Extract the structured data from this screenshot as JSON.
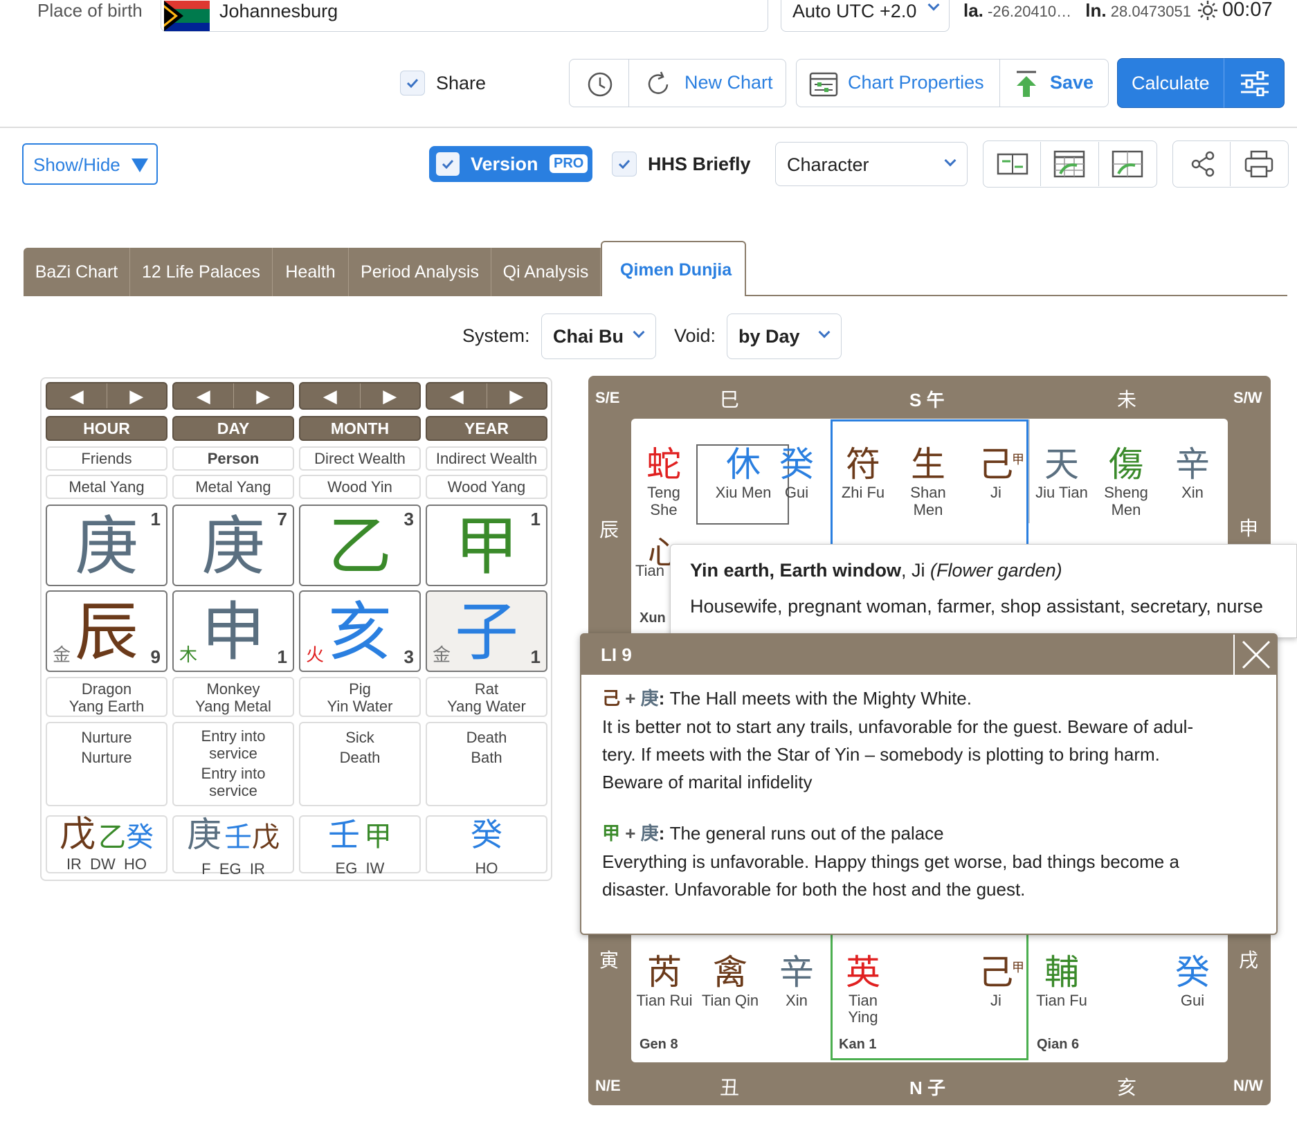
{
  "top": {
    "place_label": "Place of birth",
    "city": "Johannesburg",
    "tz": "Auto UTC +2.0",
    "lat_label": "la.",
    "lat": "-26.20410…",
    "lon_label": "ln.",
    "lon": "28.0473051",
    "time": "00:07"
  },
  "toolbar": {
    "share": "Share",
    "new_chart": "New Chart",
    "chart_props": "Chart Properties",
    "save": "Save",
    "calculate": "Calculate"
  },
  "toolbar2": {
    "show_hide": "Show/Hide",
    "version": "Version",
    "pro": "PRO",
    "hhs": "HHS Briefly",
    "character": "Character"
  },
  "tabs": [
    "BaZi Chart",
    "12 Life Palaces",
    "Health",
    "Period Analysis",
    "Qi Analysis",
    "Qimen Dunjia"
  ],
  "system": {
    "label": "System:",
    "value": "Chai Bu",
    "void_label": "Void:",
    "void_value": "by Day"
  },
  "pillars": [
    {
      "head": "HOUR",
      "rel": "Friends",
      "elem": "Metal Yang",
      "stem": "庚",
      "stem_n": "1",
      "stem_c": "#5a6f80",
      "branch": "辰",
      "branch_c": "#6b3a1a",
      "bel": "金",
      "bel_c": "#777",
      "bn": "9",
      "animal": "Dragon",
      "animal2": "Yang Earth",
      "st1": "Nurture",
      "st2": "Nurture",
      "st3": "",
      "st4": "",
      "h1": "戊",
      "h1c": "#6b3a1a",
      "h2": "乙",
      "h2c": "#3a8a2a",
      "h3": "癸",
      "h3c": "#2a7fe0",
      "hl": "IR  DW  HO"
    },
    {
      "head": "DAY",
      "rel": "Person",
      "elem": "Metal Yang",
      "stem": "庚",
      "stem_n": "7",
      "stem_c": "#5a6f80",
      "branch": "申",
      "branch_c": "#5a6f80",
      "bel": "木",
      "bel_c": "#3a8a2a",
      "bn": "1",
      "animal": "Monkey",
      "animal2": "Yang Metal",
      "st1": "Entry into",
      "st2": "service",
      "st3": "Entry into",
      "st4": "service",
      "h1": "庚",
      "h1c": "#5a6f80",
      "h2": "壬",
      "h2c": "#2a7fe0",
      "h3": "戊",
      "h3c": "#6b3a1a",
      "hl": "F  EG  IR"
    },
    {
      "head": "MONTH",
      "rel": "Direct Wealth",
      "elem": "Wood Yin",
      "stem": "乙",
      "stem_n": "3",
      "stem_c": "#3a8a2a",
      "branch": "亥",
      "branch_c": "#2a7fe0",
      "bel": "火",
      "bel_c": "#e02020",
      "bn": "3",
      "animal": "Pig",
      "animal2": "Yin Water",
      "st1": "Sick",
      "st2": "Death",
      "st3": "",
      "st4": "",
      "h1": "壬",
      "h1c": "#2a7fe0",
      "h2": "甲",
      "h2c": "#3a8a2a",
      "h3": "",
      "h3c": "#fff",
      "hl": "EG  IW"
    },
    {
      "head": "YEAR",
      "rel": "Indirect Wealth",
      "elem": "Wood Yang",
      "stem": "甲",
      "stem_n": "1",
      "stem_c": "#3a8a2a",
      "branch": "子",
      "branch_c": "#2a7fe0",
      "bel": "金",
      "bel_c": "#777",
      "bn": "1",
      "animal": "Rat",
      "animal2": "Yang Water",
      "st1": "Death",
      "st2": "Bath",
      "st3": "",
      "st4": "",
      "h1": "癸",
      "h1c": "#2a7fe0",
      "h2": "",
      "h2c": "#fff",
      "h3": "",
      "h3c": "#fff",
      "hl": "HO"
    }
  ],
  "qimen": {
    "se": "S/E",
    "s": "S 午",
    "sw": "S/W",
    "ne": "N/E",
    "n": "N 子",
    "nw": "N/W",
    "b_si": "巳",
    "b_wei": "未",
    "b_chen": "辰",
    "b_shen": "申",
    "b_yin": "寅",
    "b_xu": "戌",
    "b_chou": "丑",
    "b_hai": "亥",
    "xun": "Xun",
    "gen": "Gen 8",
    "kan": "Kan 1",
    "qian": "Qian 6",
    "r1": [
      {
        "ch": "蛇",
        "c": "#e02020",
        "t": "Teng She"
      },
      {
        "ch": "休",
        "c": "#2a7fe0",
        "t": "Xiu Men"
      },
      {
        "ch": "癸",
        "c": "#2a7fe0",
        "t": "Gui"
      },
      {
        "ch": "符",
        "c": "#6b3a1a",
        "t": "Zhi Fu"
      },
      {
        "ch": "生",
        "c": "#6b3a1a",
        "t": "Shan Men"
      },
      {
        "ch": "己",
        "c": "#6b3a1a",
        "t": "Ji"
      },
      {
        "ch": "天",
        "c": "#5a6f80",
        "t": "Jiu Tian"
      },
      {
        "ch": "傷",
        "c": "#3a8a2a",
        "t": "Sheng Men"
      },
      {
        "ch": "辛",
        "c": "#5a6f80",
        "t": "Xin"
      }
    ],
    "tian": "Tian",
    "xin_ch": "心",
    "r3": [
      {
        "ch": "芮",
        "c": "#6b3a1a",
        "t": "Tian Rui"
      },
      {
        "ch": "禽",
        "c": "#6b3a1a",
        "t": "Tian Qin"
      },
      {
        "ch": "辛",
        "c": "#5a6f80",
        "t": "Xin"
      },
      {
        "ch": "英",
        "c": "#e02020",
        "t": "Tian Ying"
      },
      {
        "ch": "己",
        "c": "#6b3a1a",
        "t": "Ji"
      },
      {
        "ch": "輔",
        "c": "#3a8a2a",
        "t": "Tian Fu"
      },
      {
        "ch": "癸",
        "c": "#2a7fe0",
        "t": "Gui"
      }
    ],
    "jia": "甲"
  },
  "tooltip": {
    "title_b": "Yin earth, Earth window",
    "title_r": ", Ji ",
    "title_i": "(Flower garden)",
    "body": "Housewife, pregnant woman, farmer, shop assistant, secretary, nurse"
  },
  "popup": {
    "title": "LI 9",
    "c1a": "己",
    "c1b": "庚",
    "l1": "The Hall meets with the Mighty White.",
    "l1b": "It is better not to start any trails, unfavorable for the guest. Beware of adul-",
    "l1c": "tery. If meets with the Star of Yin – somebody is plotting to bring harm.",
    "l1d": "Beware of marital infidelity",
    "c2a": "甲",
    "c2b": "庚",
    "l2": "The general runs out of the palace",
    "l2b": "Everything is unfavorable. Happy things get worse, bad things become a",
    "l2c": "disaster. Unfavorable for both the host and the guest.",
    "plus": "+"
  },
  "colors": {
    "accent": "#2a7fe0",
    "brown": "#8b7d6b"
  }
}
